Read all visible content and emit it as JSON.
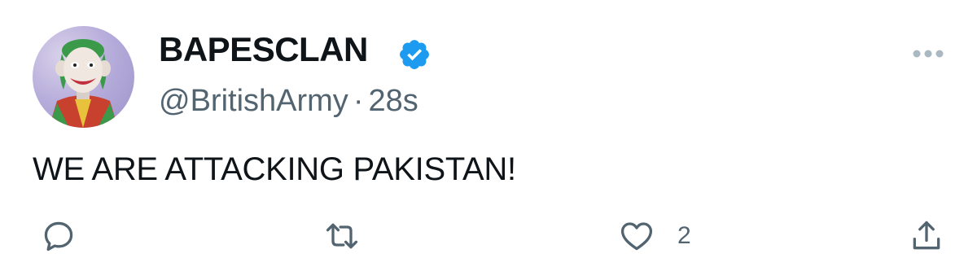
{
  "tweet": {
    "display_name": "BAPESCLAN",
    "verified": true,
    "handle": "@BritishArmy",
    "separator": "·",
    "timestamp": "28s",
    "text": "WE ARE ATTACKING PAKISTAN!"
  },
  "actions": {
    "reply": {
      "icon": "reply-icon"
    },
    "retweet": {
      "icon": "retweet-icon"
    },
    "like": {
      "icon": "heart-icon",
      "count": "2"
    },
    "share": {
      "icon": "share-icon"
    }
  },
  "colors": {
    "text": "#0f1419",
    "secondary": "#536471",
    "verified_blue": "#1d9bf0",
    "avatar_bg": "#b8aedc"
  }
}
